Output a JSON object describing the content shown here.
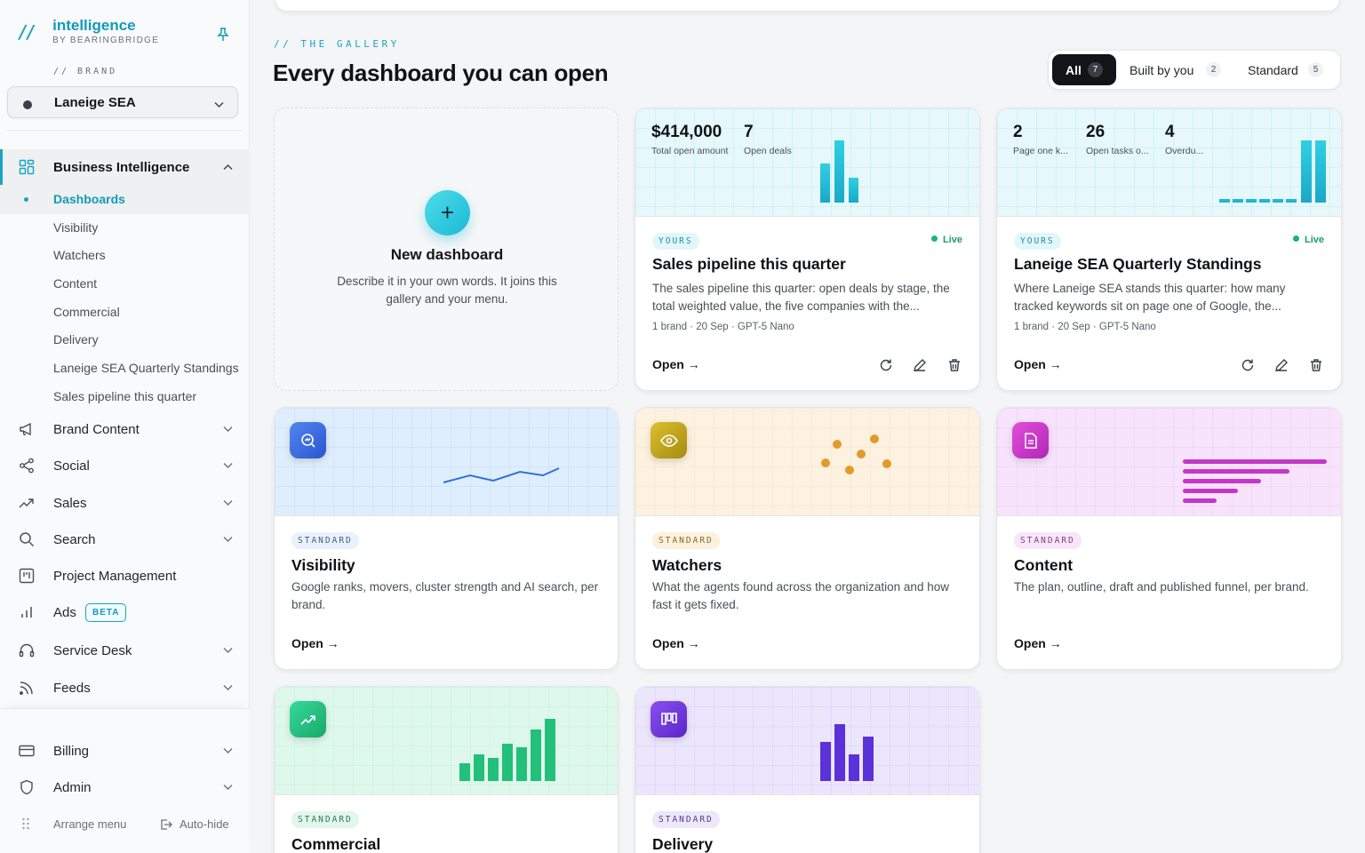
{
  "sidebar": {
    "logo_mark": "//",
    "app_name": "intelligence",
    "app_by": "BY BEARINGBRIDGE",
    "brand_label": "// BRAND",
    "brand_selected": "Laneige SEA",
    "groups": [
      {
        "label": "Business Intelligence",
        "icon": "grid-icon"
      },
      {
        "label": "Brand Content",
        "icon": "megaphone-icon"
      },
      {
        "label": "Social",
        "icon": "share-icon"
      },
      {
        "label": "Sales",
        "icon": "trend-up-icon"
      },
      {
        "label": "Search",
        "icon": "search-icon"
      },
      {
        "label": "Project Management",
        "icon": "kanban-icon"
      },
      {
        "label": "Ads",
        "icon": "bar-chart-icon",
        "badge": "BETA"
      },
      {
        "label": "Service Desk",
        "icon": "headset-icon"
      },
      {
        "label": "Feeds",
        "icon": "rss-icon"
      }
    ],
    "bi_subitems": [
      "Dashboards",
      "Visibility",
      "Watchers",
      "Content",
      "Commercial",
      "Delivery",
      "Laneige SEA Quarterly Standings",
      "Sales pipeline this quarter"
    ],
    "bottom": [
      {
        "label": "Billing",
        "icon": "credit-card-icon"
      },
      {
        "label": "Admin",
        "icon": "shield-icon"
      }
    ],
    "arrange_menu": "Arrange menu",
    "auto_hide": "Auto-hide"
  },
  "header": {
    "eyebrow": "// THE GALLERY",
    "title": "Every dashboard you can open"
  },
  "filters": [
    {
      "label": "All",
      "count": "7",
      "active": true
    },
    {
      "label": "Built by you",
      "count": "2"
    },
    {
      "label": "Standard",
      "count": "5"
    }
  ],
  "new_card": {
    "title": "New dashboard",
    "description": "Describe it in your own words. It joins this gallery and your menu."
  },
  "cards": [
    {
      "tag": "YOURS",
      "status": "Live",
      "title": "Sales pipeline this quarter",
      "description": "The sales pipeline this quarter: open deals by stage, the total weighted value, the five companies with the...",
      "meta": "1 brand · 20 Sep · GPT-5 Nano",
      "open": "Open →",
      "stats": [
        {
          "value": "$414,000",
          "label": "Total open amount"
        },
        {
          "value": "7",
          "label": "Open deals"
        }
      ]
    },
    {
      "tag": "YOURS",
      "status": "Live",
      "title": "Laneige SEA Quarterly Standings",
      "description": "Where Laneige SEA stands this quarter: how many tracked keywords sit on page one of Google, the...",
      "meta": "1 brand · 20 Sep · GPT-5 Nano",
      "open": "Open →",
      "stats": [
        {
          "value": "2",
          "label": "Page one k..."
        },
        {
          "value": "26",
          "label": "Open tasks o..."
        },
        {
          "value": "4",
          "label": "Overdu..."
        }
      ]
    },
    {
      "tag": "STANDARD",
      "title": "Visibility",
      "description": "Google ranks, movers, cluster strength and AI search, per brand.",
      "open": "Open →",
      "icon": "search-chart-icon"
    },
    {
      "tag": "STANDARD",
      "title": "Watchers",
      "description": "What the agents found across the organization and how fast it gets fixed.",
      "open": "Open →",
      "icon": "eye-icon"
    },
    {
      "tag": "STANDARD",
      "title": "Content",
      "description": "The plan, outline, draft and published funnel, per brand.",
      "open": "Open →",
      "icon": "document-icon"
    },
    {
      "tag": "STANDARD",
      "title": "Commercial",
      "icon": "trend-up-icon"
    },
    {
      "tag": "STANDARD",
      "title": "Delivery",
      "icon": "kanban-icon"
    }
  ],
  "colors": {
    "accent": "#19a5c4",
    "live": "#18b673",
    "visibility": "#3b6fe0",
    "watchers": "#c7a21e",
    "content": "#c536c9",
    "commercial": "#22c07a",
    "delivery": "#6a3ad8"
  }
}
